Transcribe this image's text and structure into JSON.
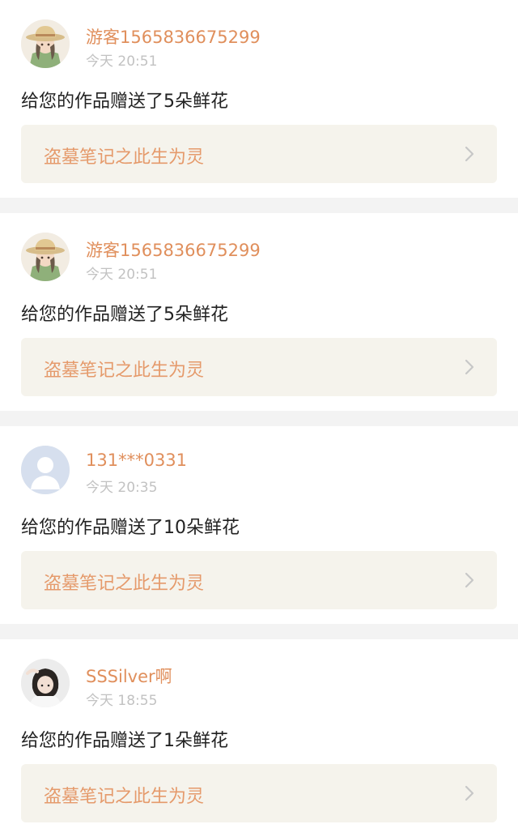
{
  "feed": {
    "items": [
      {
        "avatar": "girl-straw-hat-avatar",
        "username": "游客1565836675299",
        "time": "今天 20:51",
        "message": "给您的作品赠送了5朵鲜花",
        "work_title": "盗墓笔记之此生为灵"
      },
      {
        "avatar": "girl-straw-hat-avatar",
        "username": "游客1565836675299",
        "time": "今天 20:51",
        "message": "给您的作品赠送了5朵鲜花",
        "work_title": "盗墓笔记之此生为灵"
      },
      {
        "avatar": "default-user-avatar",
        "username": "131***0331",
        "time": "今天 20:35",
        "message": "给您的作品赠送了10朵鲜花",
        "work_title": "盗墓笔记之此生为灵"
      },
      {
        "avatar": "dark-hair-girl-avatar",
        "username": "SSSilver啊",
        "time": "今天 18:55",
        "message": "给您的作品赠送了1朵鲜花",
        "work_title": "盗墓笔记之此生为灵"
      }
    ]
  },
  "colors": {
    "username": "#e08f5c",
    "work_title": "#e59a6b",
    "work_card_bg": "#f5f3ec",
    "time": "#c2c2c2",
    "message": "#222222",
    "divider": "#f3f3f3"
  },
  "icons": {
    "chevron": "chevron-right-icon"
  }
}
